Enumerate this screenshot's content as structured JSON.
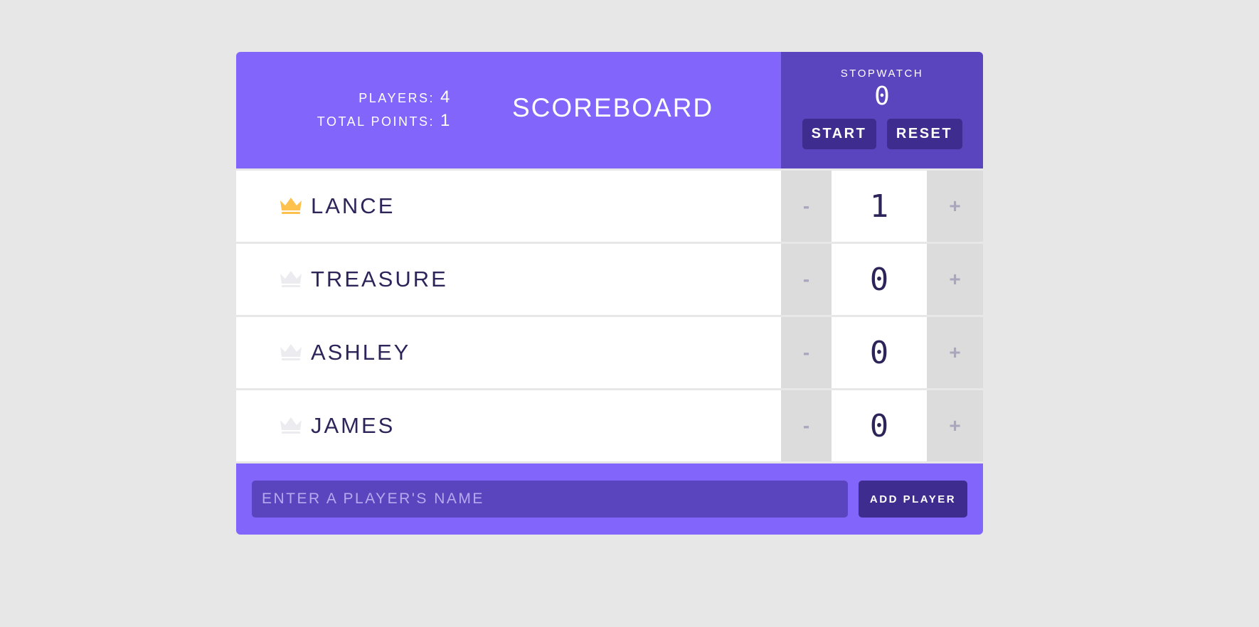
{
  "header": {
    "title": "SCOREBOARD",
    "players_label": "PLAYERS:",
    "players_value": "4",
    "points_label": "TOTAL POINTS:",
    "points_value": "1"
  },
  "stopwatch": {
    "label": "STOPWATCH",
    "time": "0",
    "start_label": "START",
    "reset_label": "RESET"
  },
  "players": [
    {
      "name": "LANCE",
      "score": "1",
      "leader": true
    },
    {
      "name": "TREASURE",
      "score": "0",
      "leader": false
    },
    {
      "name": "ASHLEY",
      "score": "0",
      "leader": false
    },
    {
      "name": "JAMES",
      "score": "0",
      "leader": false
    }
  ],
  "counter": {
    "decrement_label": "-",
    "increment_label": "+"
  },
  "footer": {
    "input_placeholder": "ENTER A PLAYER'S NAME",
    "input_value": "",
    "add_label": "ADD PLAYER"
  },
  "colors": {
    "accent": "#8265fa",
    "accent_dark": "#5b45be",
    "button": "#3e2d8e",
    "crown_leader": "#ffc14d",
    "crown_idle": "#ececf0",
    "text_dark": "#2d2459"
  }
}
